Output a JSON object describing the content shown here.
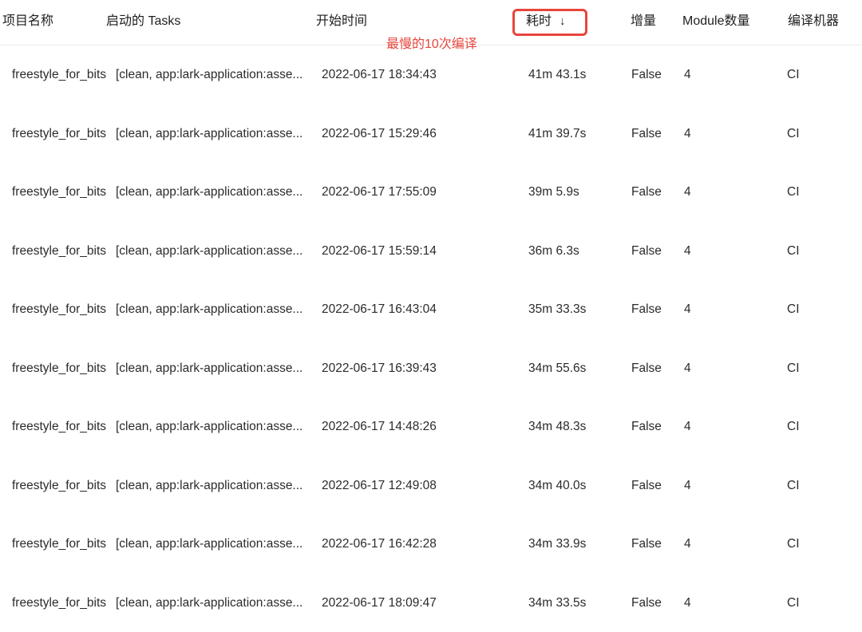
{
  "table": {
    "headers": {
      "project_name": "项目名称",
      "tasks": "启动的 Tasks",
      "start_time": "开始时间",
      "duration": "耗时",
      "incremental": "增量",
      "module_count": "Module数量",
      "build_machine": "编译机器"
    },
    "sort_indicator": "↓",
    "annotation": "最慢的10次编译",
    "rows": [
      {
        "project": "freestyle_for_bits",
        "tasks": "[clean, app:lark-application:asse...",
        "start": "2022-06-17 18:34:43",
        "duration": "41m 43.1s",
        "incremental": "False",
        "modules": "4",
        "machine": "CI"
      },
      {
        "project": "freestyle_for_bits",
        "tasks": "[clean, app:lark-application:asse...",
        "start": "2022-06-17 15:29:46",
        "duration": "41m 39.7s",
        "incremental": "False",
        "modules": "4",
        "machine": "CI"
      },
      {
        "project": "freestyle_for_bits",
        "tasks": "[clean, app:lark-application:asse...",
        "start": "2022-06-17 17:55:09",
        "duration": "39m 5.9s",
        "incremental": "False",
        "modules": "4",
        "machine": "CI"
      },
      {
        "project": "freestyle_for_bits",
        "tasks": "[clean, app:lark-application:asse...",
        "start": "2022-06-17 15:59:14",
        "duration": "36m 6.3s",
        "incremental": "False",
        "modules": "4",
        "machine": "CI"
      },
      {
        "project": "freestyle_for_bits",
        "tasks": "[clean, app:lark-application:asse...",
        "start": "2022-06-17 16:43:04",
        "duration": "35m 33.3s",
        "incremental": "False",
        "modules": "4",
        "machine": "CI"
      },
      {
        "project": "freestyle_for_bits",
        "tasks": "[clean, app:lark-application:asse...",
        "start": "2022-06-17 16:39:43",
        "duration": "34m 55.6s",
        "incremental": "False",
        "modules": "4",
        "machine": "CI"
      },
      {
        "project": "freestyle_for_bits",
        "tasks": "[clean, app:lark-application:asse...",
        "start": "2022-06-17 14:48:26",
        "duration": "34m 48.3s",
        "incremental": "False",
        "modules": "4",
        "machine": "CI"
      },
      {
        "project": "freestyle_for_bits",
        "tasks": "[clean, app:lark-application:asse...",
        "start": "2022-06-17 12:49:08",
        "duration": "34m 40.0s",
        "incremental": "False",
        "modules": "4",
        "machine": "CI"
      },
      {
        "project": "freestyle_for_bits",
        "tasks": "[clean, app:lark-application:asse...",
        "start": "2022-06-17 16:42:28",
        "duration": "34m 33.9s",
        "incremental": "False",
        "modules": "4",
        "machine": "CI"
      },
      {
        "project": "freestyle_for_bits",
        "tasks": "[clean, app:lark-application:asse...",
        "start": "2022-06-17 18:09:47",
        "duration": "34m 33.5s",
        "incremental": "False",
        "modules": "4",
        "machine": "CI"
      }
    ]
  }
}
